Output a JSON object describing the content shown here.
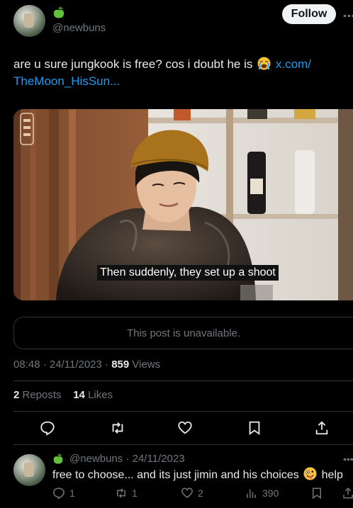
{
  "post": {
    "handle": "@newbuns",
    "follow_label": "Follow",
    "text_before_emoji": "are u sure jungkook is free? cos i doubt he is",
    "link_line1": "x.com/",
    "link_line2": "TheMoon_HisSun...",
    "media_caption": "Then suddenly, they set up a shoot",
    "quoted_unavailable": "This post is unavailable.",
    "time": "08:48",
    "date": "24/11/2023",
    "views_count": "859",
    "views_label": "Views",
    "reposts_count": "2",
    "reposts_label": "Reposts",
    "likes_count": "14",
    "likes_label": "Likes"
  },
  "reply": {
    "handle": "@newbuns",
    "date": "24/11/2023",
    "text_before_emoji": "free to choose... and its just jimin and his choices",
    "text_after_emoji": "help",
    "replies_count": "1",
    "reposts_count": "1",
    "likes_count": "2",
    "views_count": "390"
  },
  "icons": {
    "author_badge": "green-apple-emoji",
    "post_emoji": "loudly-crying-face-emoji",
    "reply_emoji": "zany-face-emoji"
  },
  "colors": {
    "background": "#000000",
    "text": "#e7e9ea",
    "muted": "#71767b",
    "link": "#1d9bf0",
    "divider": "#2f3336",
    "follow_bg": "#eff3f4"
  }
}
